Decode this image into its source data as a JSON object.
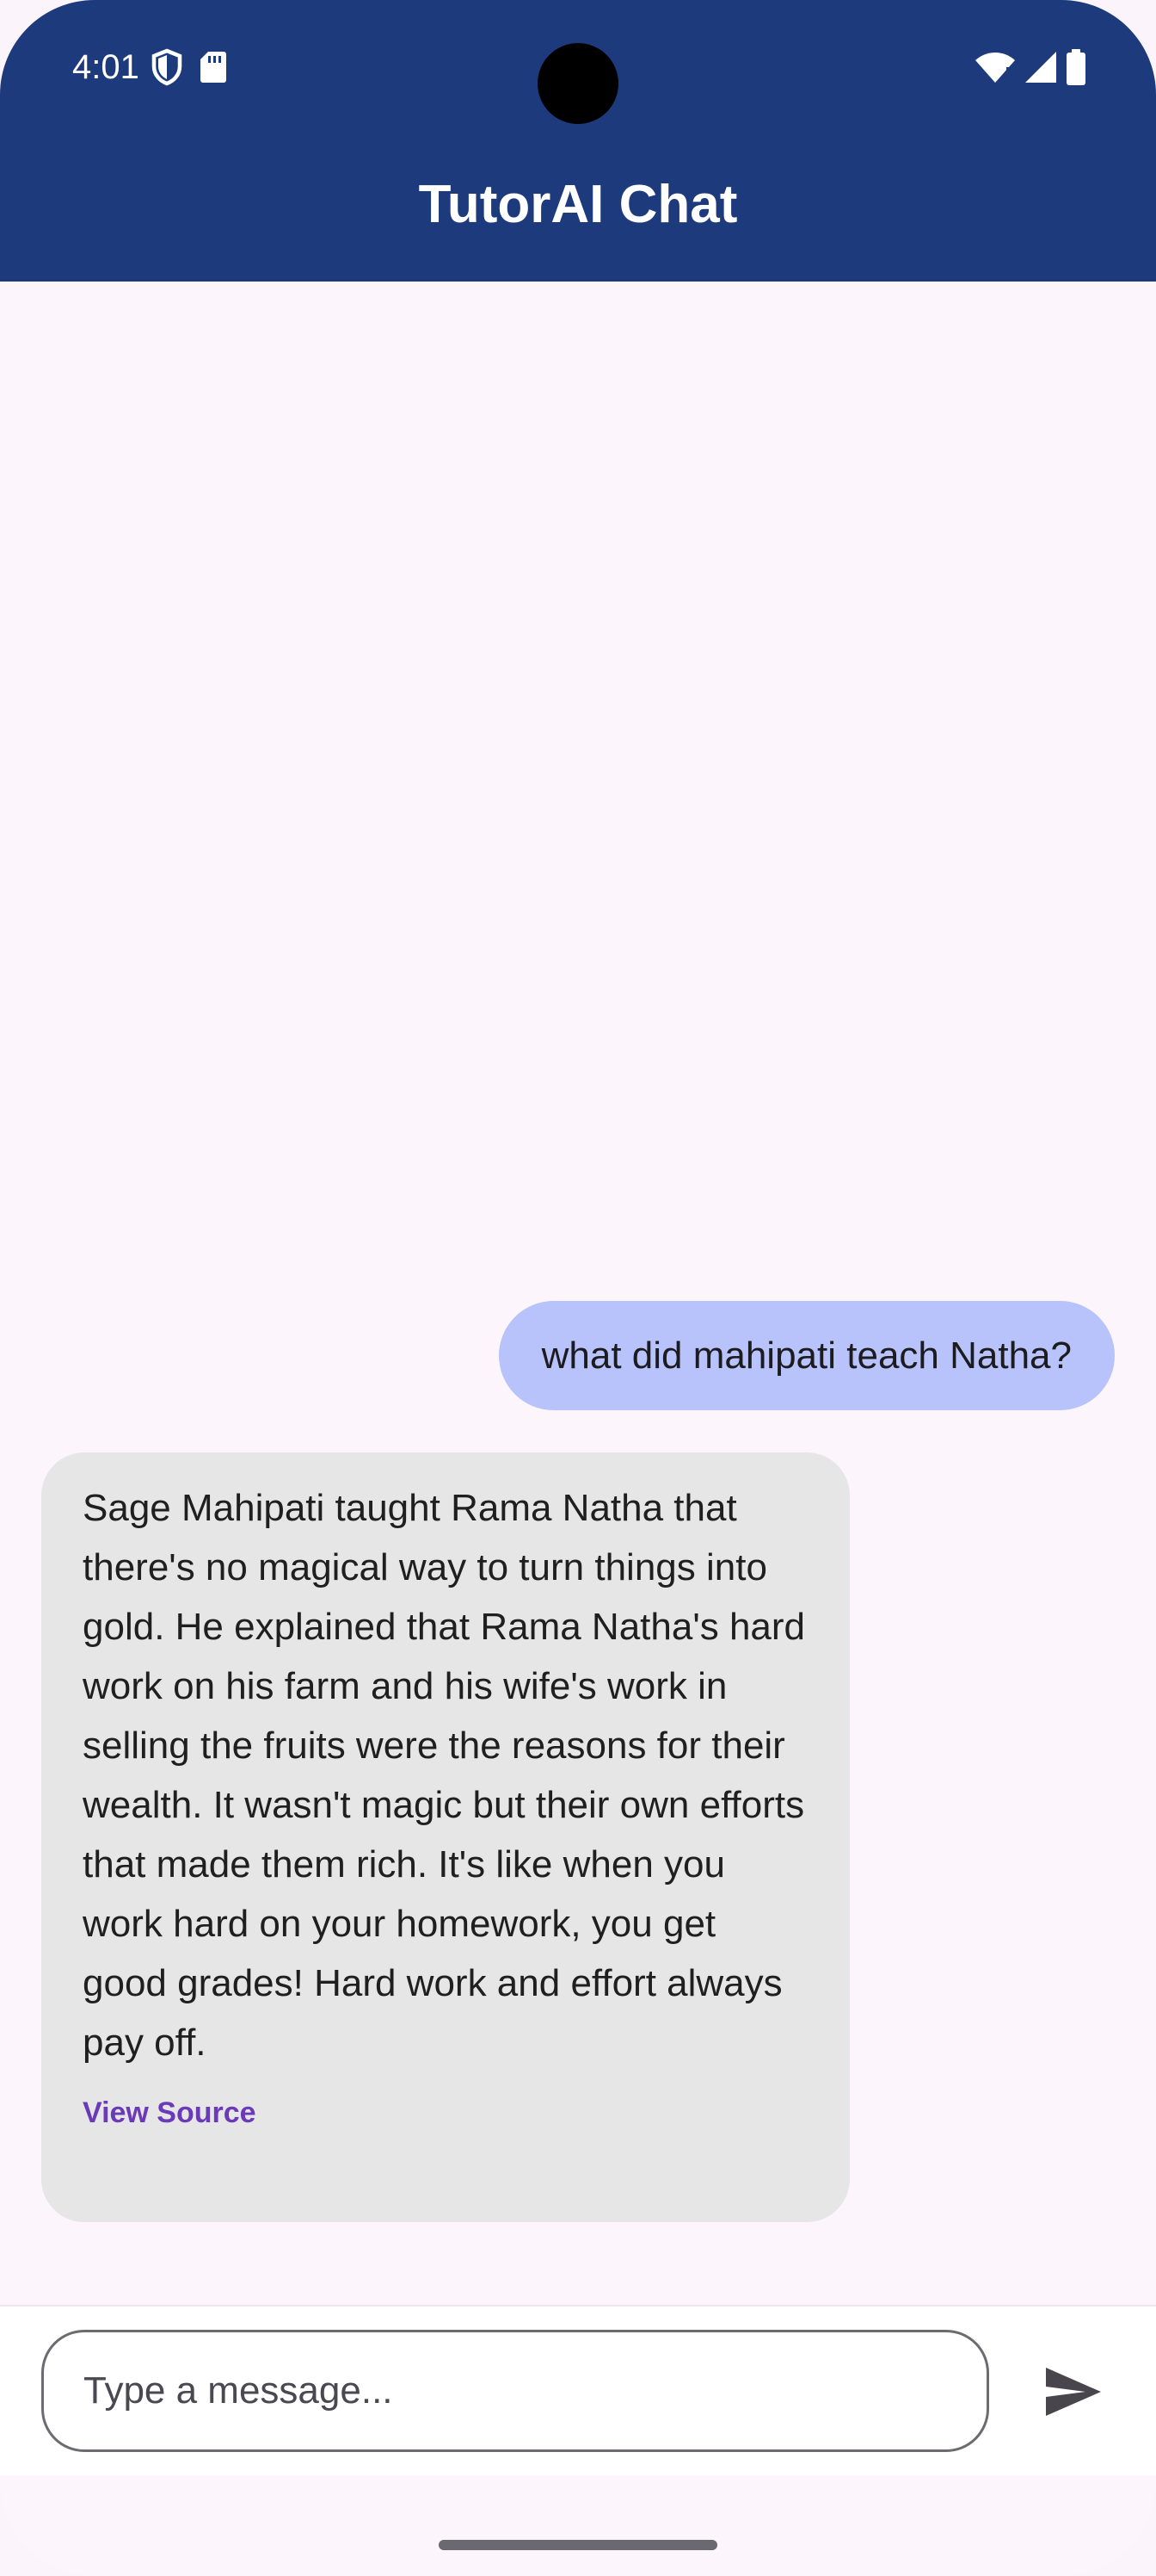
{
  "status_bar": {
    "time": "4:01",
    "left_icons": [
      "shield-icon",
      "sd-card-icon"
    ],
    "right_icons": [
      "wifi-icon",
      "signal-icon",
      "battery-icon"
    ]
  },
  "app_bar": {
    "title": "TutorAI Chat",
    "background": "#1d3a7c"
  },
  "messages": [
    {
      "sender": "user",
      "text": "what did mahipati teach Natha?",
      "color": "#b8c3fb"
    },
    {
      "sender": "bot",
      "text": "Sage Mahipati taught Rama Natha that there's no magical way to turn things into gold. He explained that Rama Natha's hard work on his farm and his wife's work in selling the fruits were the reasons for their wealth. It wasn't magic but their own efforts that made them rich. It's like when you work hard on your homework, you get good grades! Hard work and effort always pay off.",
      "link_label": "View Source",
      "color": "#e6e6e6"
    }
  ],
  "composer": {
    "placeholder": "Type a message...",
    "value": "",
    "send_icon": "send-icon"
  }
}
